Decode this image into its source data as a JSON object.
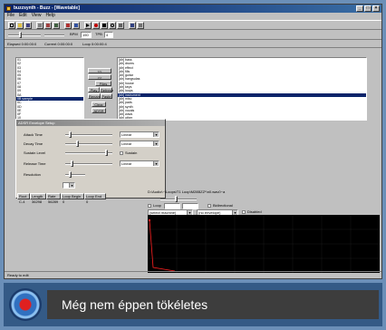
{
  "window": {
    "title": "buzzsynth - Buzz - [Wavetable]"
  },
  "menu": [
    "File",
    "Edit",
    "View",
    "Help"
  ],
  "transport": {
    "bpm_label": "BPM",
    "bpm_value": "150",
    "tpb_label": "TPB",
    "tpb_value": "4"
  },
  "status_line": {
    "elapsed": "Elapsed 0:00:00:0",
    "current": "Current 0:00:00:0",
    "loop": "Loop 0:00:00:4"
  },
  "left_list": {
    "items": [
      "01",
      "02",
      "03",
      "04",
      "05",
      "06",
      "07",
      "08",
      "09",
      "0A",
      "0B",
      "0C",
      "0D",
      "0E",
      "0F",
      "10",
      "11",
      "12",
      "13",
      "14"
    ],
    "selected_index": 10,
    "selected_label": "0B sample"
  },
  "buttons": {
    "add": "<<",
    "remove": ">>",
    "files": "Files",
    "play": "Play",
    "refresh": "Refresh",
    "rename": "Rename",
    "paste": "Paste",
    "clear": "Clear",
    "adsr": "ADSR"
  },
  "file_list": {
    "items": [
      "[dir] bass",
      "[dir] drums",
      "[dir] effect",
      "[dir] fills",
      "[dir] guitar",
      "[dir] hangsulas",
      "[dir] house",
      "[dir] keys",
      "[dir] loops",
      "[dir] instrument",
      "[dir] misc",
      "[dir] pads",
      "[dir] synth",
      "[dir] vocals",
      "[dir] wavs",
      "[dir] other"
    ],
    "selected_index": 9
  },
  "adsr_dialog": {
    "title": "ADSR Envelope Setup",
    "rows": [
      {
        "label": "Attack Time",
        "option": "Linear"
      },
      {
        "label": "Decay Time",
        "option": "Linear"
      },
      {
        "label": "Sustain Level",
        "option": "Sustain"
      },
      {
        "label": "Release Time",
        "option": "Linear"
      },
      {
        "label": "Resolution",
        "option": ""
      }
    ]
  },
  "sample_table": {
    "headers": [
      "Root",
      "Length",
      "Rate",
      "Loop Begin",
      "Loop End"
    ],
    "row": [
      "C-4",
      "36298",
      "56289",
      "0",
      "0"
    ]
  },
  "right_panel": {
    "path": "D:\\Audio\\~\\Loops\\T1 Loop\\M28BZZ*\\n0.wav0~a",
    "loop_label": "Loop",
    "bidirectional_label": "Bidirectional",
    "machine_select": "(select machine)",
    "envelope_select": "(no envelope)",
    "disabled_label": "Disabled"
  },
  "statusbar": {
    "text": "Ready to edit"
  },
  "caption": {
    "text": "Még nem éppen tökéletes"
  },
  "colors": {
    "selection": "#0a246a",
    "titlebar": "#0a246a",
    "caption_bg": "#3d3d3d",
    "wave_bg": "#000000",
    "wave_line": "#ff2020"
  }
}
